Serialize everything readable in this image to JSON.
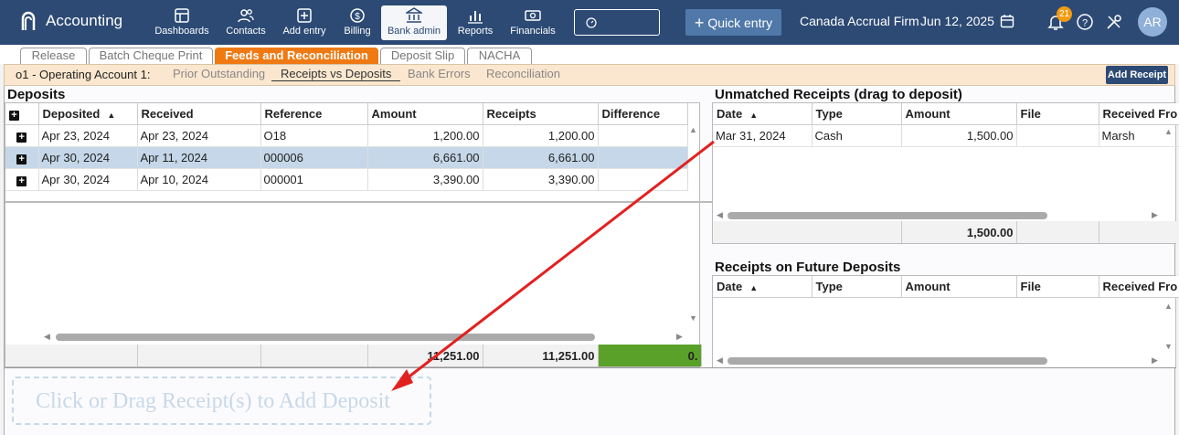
{
  "app": {
    "title": "Accounting"
  },
  "nav": [
    {
      "label": "Dashboards",
      "icon": "dashboard-icon"
    },
    {
      "label": "Contacts",
      "icon": "contacts-icon"
    },
    {
      "label": "Add entry",
      "icon": "add-entry-icon"
    },
    {
      "label": "Billing",
      "icon": "billing-icon"
    },
    {
      "label": "Bank admin",
      "icon": "bank-icon",
      "active": true
    },
    {
      "label": "Reports",
      "icon": "reports-icon"
    },
    {
      "label": "Financials",
      "icon": "financials-icon"
    }
  ],
  "header": {
    "quick_entry": "Quick entry",
    "firm": "Canada Accrual Firm",
    "date": "Jun 12, 2025",
    "notifications": "21",
    "avatar": "AR"
  },
  "tabs": [
    "Release",
    "Batch Cheque Print",
    "Feeds and Reconciliation",
    "Deposit Slip",
    "NACHA"
  ],
  "active_tab": "Feeds and Reconciliation",
  "subbar": {
    "account": "o1 - Operating Account 1:",
    "tabs": [
      "Prior Outstanding",
      "Receipts vs Deposits",
      "Bank Errors",
      "Reconciliation"
    ],
    "active": "Receipts vs Deposits",
    "add_receipt": "Add Receipt"
  },
  "deposits": {
    "title": "Deposits",
    "columns": [
      "Deposited",
      "Received",
      "Reference",
      "Amount",
      "Receipts",
      "Difference"
    ],
    "rows": [
      {
        "deposited": "Apr 23, 2024",
        "received": "Apr 23, 2024",
        "reference": "O18",
        "amount": "1,200.00",
        "receipts": "1,200.00",
        "difference": ""
      },
      {
        "deposited": "Apr 30, 2024",
        "received": "Apr 11, 2024",
        "reference": "000006",
        "amount": "6,661.00",
        "receipts": "6,661.00",
        "difference": ""
      },
      {
        "deposited": "Apr 30, 2024",
        "received": "Apr 10, 2024",
        "reference": "000001",
        "amount": "3,390.00",
        "receipts": "3,390.00",
        "difference": ""
      }
    ],
    "selected_row": 1,
    "totals": {
      "amount": "11,251.00",
      "receipts": "11,251.00",
      "difference": "0."
    }
  },
  "unmatched": {
    "title": "Unmatched Receipts (drag to deposit)",
    "columns": [
      "Date",
      "Type",
      "Amount",
      "File",
      "Received Fro"
    ],
    "rows": [
      {
        "date": "Mar 31, 2024",
        "type": "Cash",
        "amount": "1,500.00",
        "file": "",
        "from": "Marsh"
      }
    ],
    "total_amount": "1,500.00"
  },
  "future": {
    "title": "Receipts on Future Deposits",
    "columns": [
      "Date",
      "Type",
      "Amount",
      "File",
      "Received Fro"
    ]
  },
  "dropzone": {
    "label": "Click or Drag Receipt(s) to Add Deposit"
  },
  "colors": {
    "nav_bg": "#2c4a74",
    "active_tab": "#ef7a14",
    "selected_row": "#c5d7e8",
    "arrow": "#e32020",
    "diff_total": "#5aa12a"
  }
}
